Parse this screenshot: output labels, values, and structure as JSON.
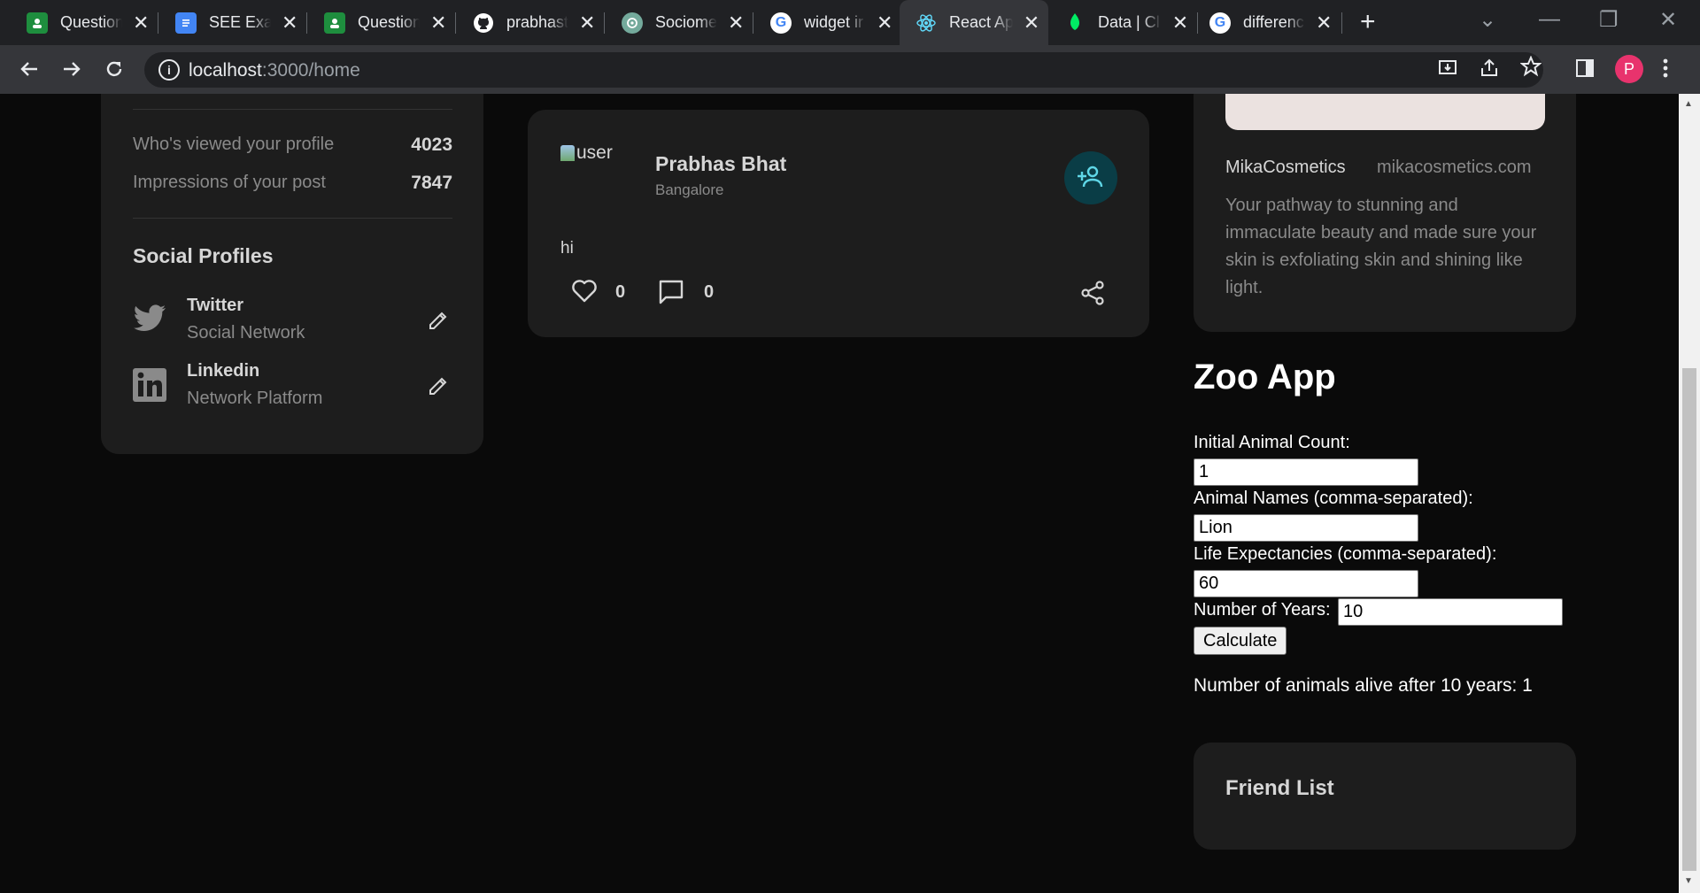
{
  "browser": {
    "tabs": [
      {
        "title": "Question",
        "favicon": "forms-icon",
        "color": "#1e8e3e"
      },
      {
        "title": "SEE Exam",
        "favicon": "docs-icon",
        "color": "#4285f4"
      },
      {
        "title": "Question",
        "favicon": "forms-icon",
        "color": "#1e8e3e"
      },
      {
        "title": "prabhast",
        "favicon": "github-icon",
        "color": "#ffffff"
      },
      {
        "title": "Sociome",
        "favicon": "chatgpt-icon",
        "color": "#74aa9c"
      },
      {
        "title": "widget ir",
        "favicon": "google-icon",
        "color": "#ffffff"
      },
      {
        "title": "React Ap",
        "favicon": "react-icon",
        "color": "#61dafb"
      },
      {
        "title": "Data | Cl",
        "favicon": "mongodb-icon",
        "color": "#00ed64"
      },
      {
        "title": "differenc",
        "favicon": "google-icon",
        "color": "#ffffff"
      }
    ],
    "active_tab": 6,
    "url_host": "localhost",
    "url_rest": ":3000/home",
    "profile_initial": "P",
    "profile_color": "#e8336d"
  },
  "profile_card": {
    "stats": [
      {
        "label": "Who's viewed your profile",
        "value": "4023"
      },
      {
        "label": "Impressions of your post",
        "value": "7847"
      }
    ],
    "social_heading": "Social Profiles",
    "social": [
      {
        "name": "Twitter",
        "sub": "Social Network",
        "icon": "twitter-icon"
      },
      {
        "name": "Linkedin",
        "sub": "Network Platform",
        "icon": "linkedin-icon"
      }
    ]
  },
  "post": {
    "avatar_alt": "user",
    "name": "Prabhas Bhat",
    "location": "Bangalore",
    "text": "hi",
    "likes": "0",
    "comments": "0",
    "accent": "#0a3d46"
  },
  "ad": {
    "name": "MikaCosmetics",
    "site": "mikacosmetics.com",
    "description": "Your pathway to stunning and immaculate beauty and made sure your skin is exfoliating skin and shining like light."
  },
  "zoo": {
    "title": "Zoo App",
    "count_label": "Initial Animal Count:",
    "count_value": "1",
    "names_label": "Animal Names (comma-separated):",
    "names_value": "Lion",
    "life_label": "Life Expectancies (comma-separated):",
    "life_value": "60",
    "years_label": "Number of Years:",
    "years_value": "10",
    "calculate_label": "Calculate",
    "result": "Number of animals alive after 10 years: 1"
  },
  "friends": {
    "title": "Friend List"
  }
}
